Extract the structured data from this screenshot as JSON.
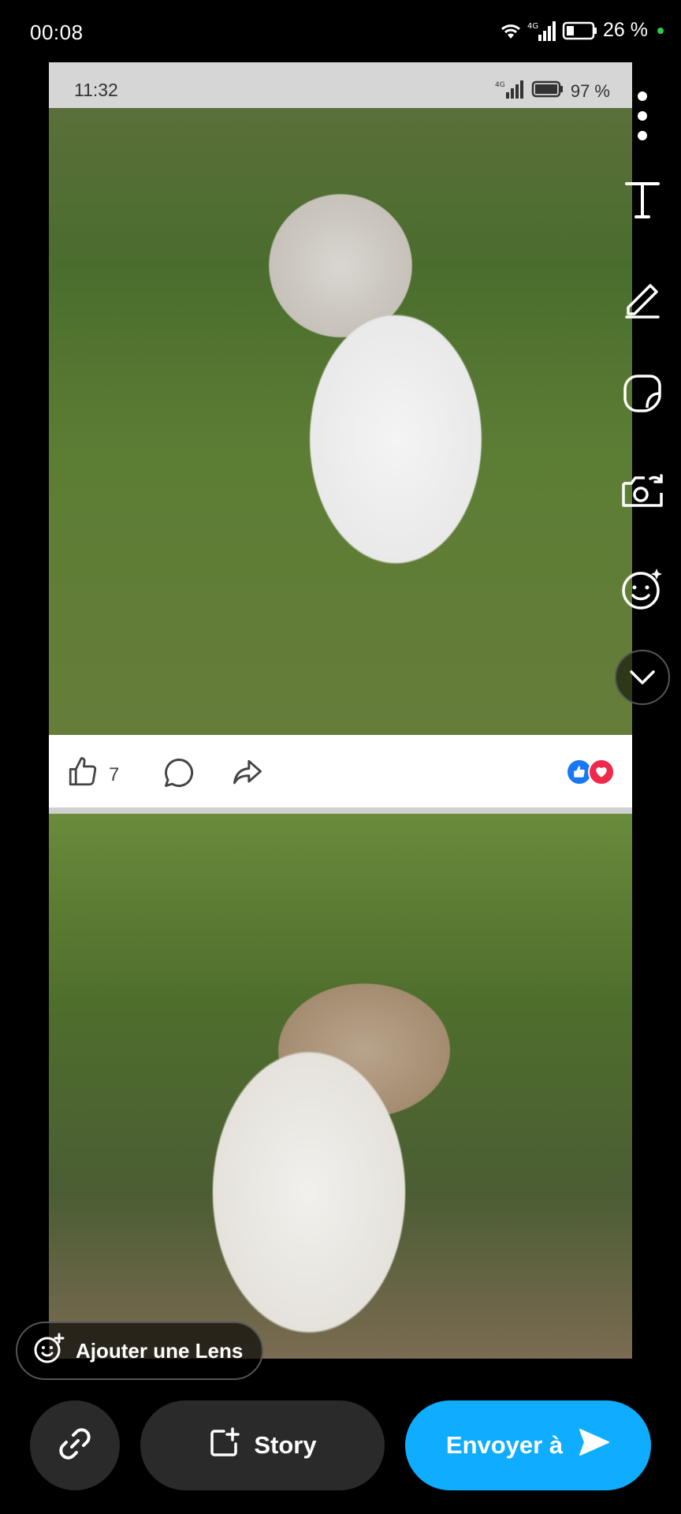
{
  "status_bar": {
    "time": "00:08",
    "battery": "26 %",
    "network": "4G",
    "icons": [
      "wifi-icon",
      "signal-icon",
      "battery-icon"
    ]
  },
  "snap": {
    "inner_status": {
      "time": "11:32",
      "network": "4G",
      "battery": "97 %"
    },
    "reactions": {
      "like_count": "7",
      "icons": [
        "like-icon",
        "comment-icon",
        "share-icon"
      ],
      "badge_colors": {
        "like": "#1877f2",
        "love": "#f02849"
      }
    }
  },
  "toolbar": {
    "items": [
      "more-icon",
      "text-icon",
      "pen-icon",
      "sticker-icon",
      "camera-flip-icon",
      "lens-icon",
      "chevron-down-icon"
    ]
  },
  "lens": {
    "label": "Ajouter une Lens"
  },
  "bottom": {
    "story_label": "Story",
    "send_label": "Envoyer à",
    "accent": "#0fadff"
  }
}
